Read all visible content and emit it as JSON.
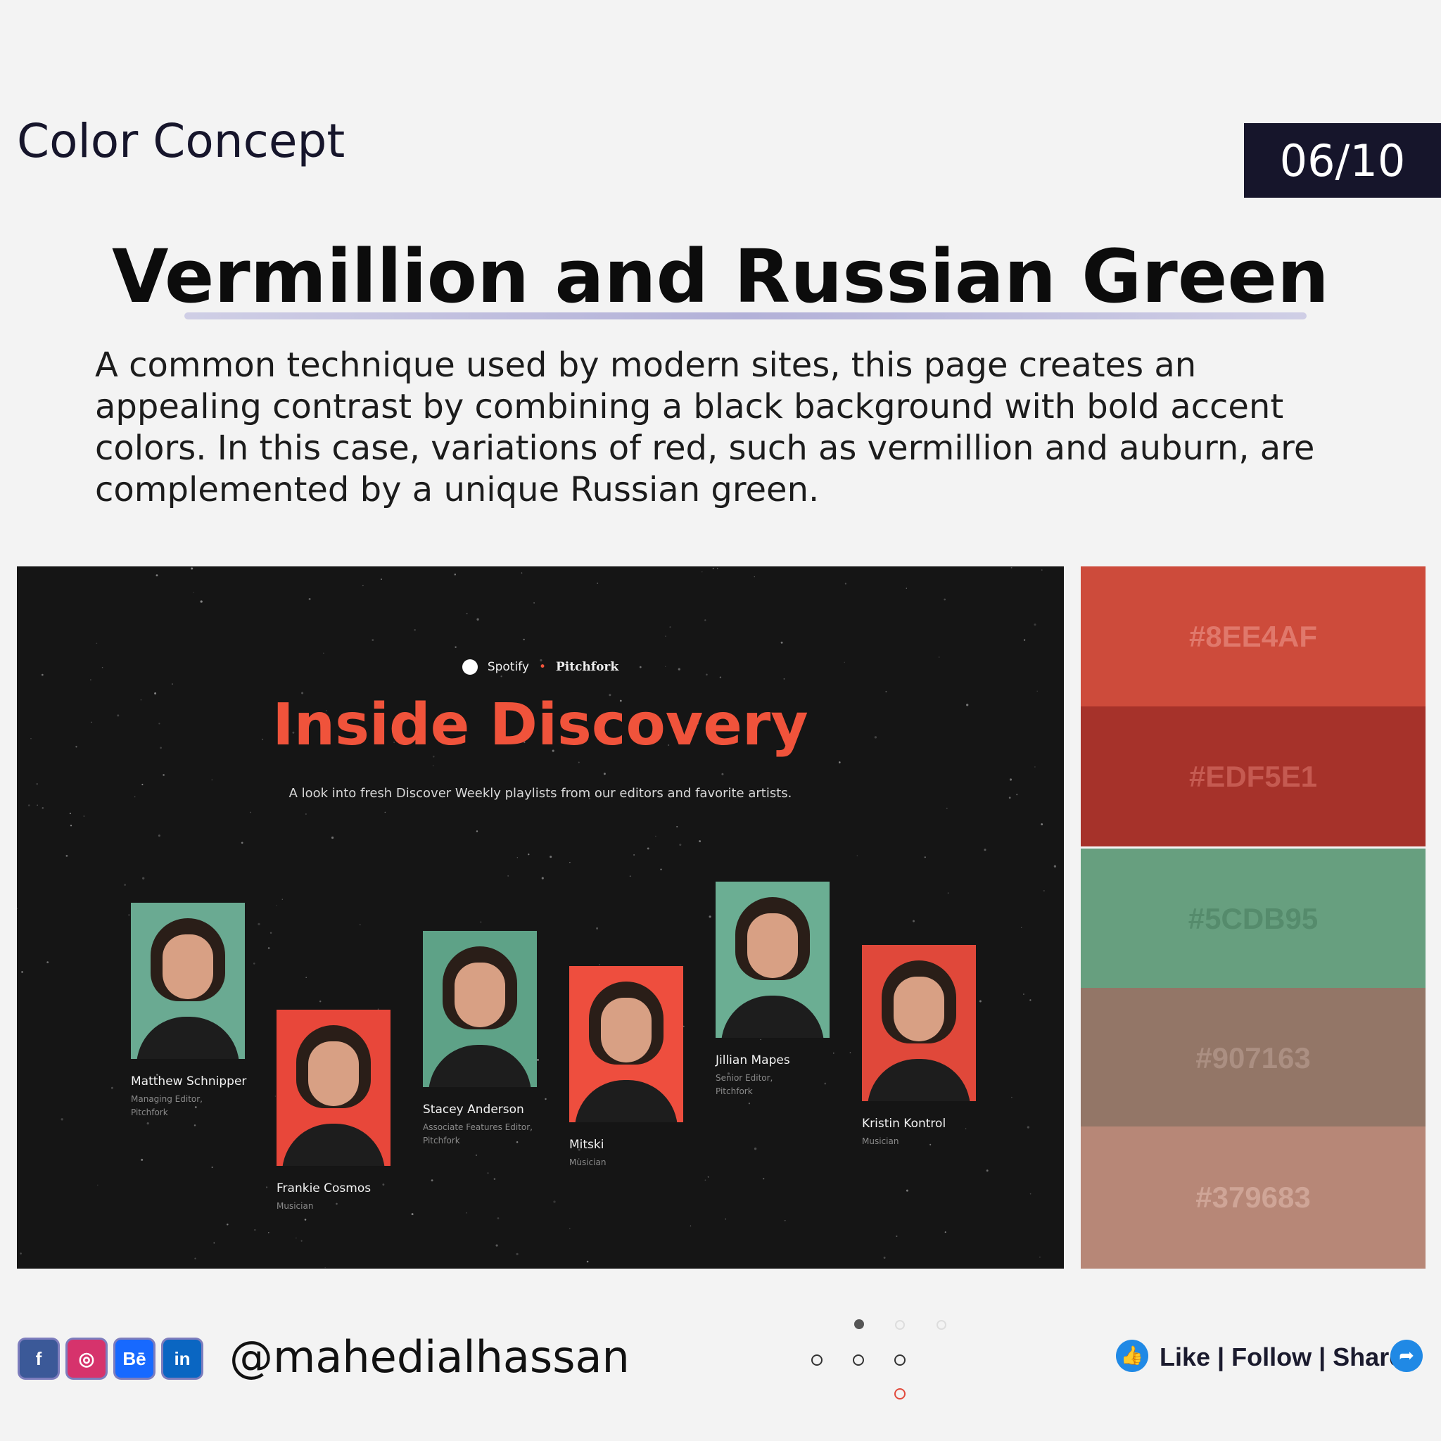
{
  "header": {
    "section_label": "Color Concept",
    "page_counter": "06/10"
  },
  "headline": "Vermillion and Russian Green",
  "description": "A common technique used by modern sites, this page creates an appealing contrast by combining a black background with bold accent colors. In this case, variations of red, such as vermillion and auburn, are complemented by a unique Russian green.",
  "showcase": {
    "brand_left": "Spotify",
    "brand_separator": "•",
    "brand_right": "Pitchfork",
    "title": "Inside Discovery",
    "subtitle": "A look into fresh Discover Weekly playlists from our editors and favorite artists.",
    "people": [
      {
        "name": "Matthew Schnipper",
        "role": "Managing Editor,\nPitchfork",
        "bg": "#6aaa92"
      },
      {
        "name": "Frankie Cosmos",
        "role": "Musician",
        "bg": "#e8473a"
      },
      {
        "name": "Stacey Anderson",
        "role": "Associate Features Editor,\nPitchfork",
        "bg": "#5ea287"
      },
      {
        "name": "Mitski",
        "role": "Musician",
        "bg": "#ee4e3e"
      },
      {
        "name": "Jillian Mapes",
        "role": "Senior Editor,\nPitchfork",
        "bg": "#6bae93"
      },
      {
        "name": "Kristin Kontrol",
        "role": "Musician",
        "bg": "#e0483a"
      }
    ]
  },
  "palette": [
    {
      "label": "#8EE4AF",
      "color": "#cd4b3b",
      "text_color": "#e0786b"
    },
    {
      "label": "#EDF5E1",
      "color": "#a6322a",
      "text_color": "#c55a51"
    },
    {
      "label": "#5CDB95",
      "color": "#679f7f",
      "text_color": "#558b6c"
    },
    {
      "label": "#907163",
      "color": "#937667",
      "text_color": "#ab8f82"
    },
    {
      "label": "#379683",
      "color": "#b78777",
      "text_color": "#cfa597"
    }
  ],
  "footer": {
    "social_icons": [
      {
        "name": "facebook-icon",
        "glyph": "f",
        "color": "#3b5998"
      },
      {
        "name": "instagram-icon",
        "glyph": "◎",
        "color": "#d6336c"
      },
      {
        "name": "behance-icon",
        "glyph": "Bē",
        "color": "#1769ff"
      },
      {
        "name": "linkedin-icon",
        "glyph": "in",
        "color": "#0a66c2"
      }
    ],
    "handle": "@mahedialhassan",
    "cta": "Like | Follow | Share"
  }
}
